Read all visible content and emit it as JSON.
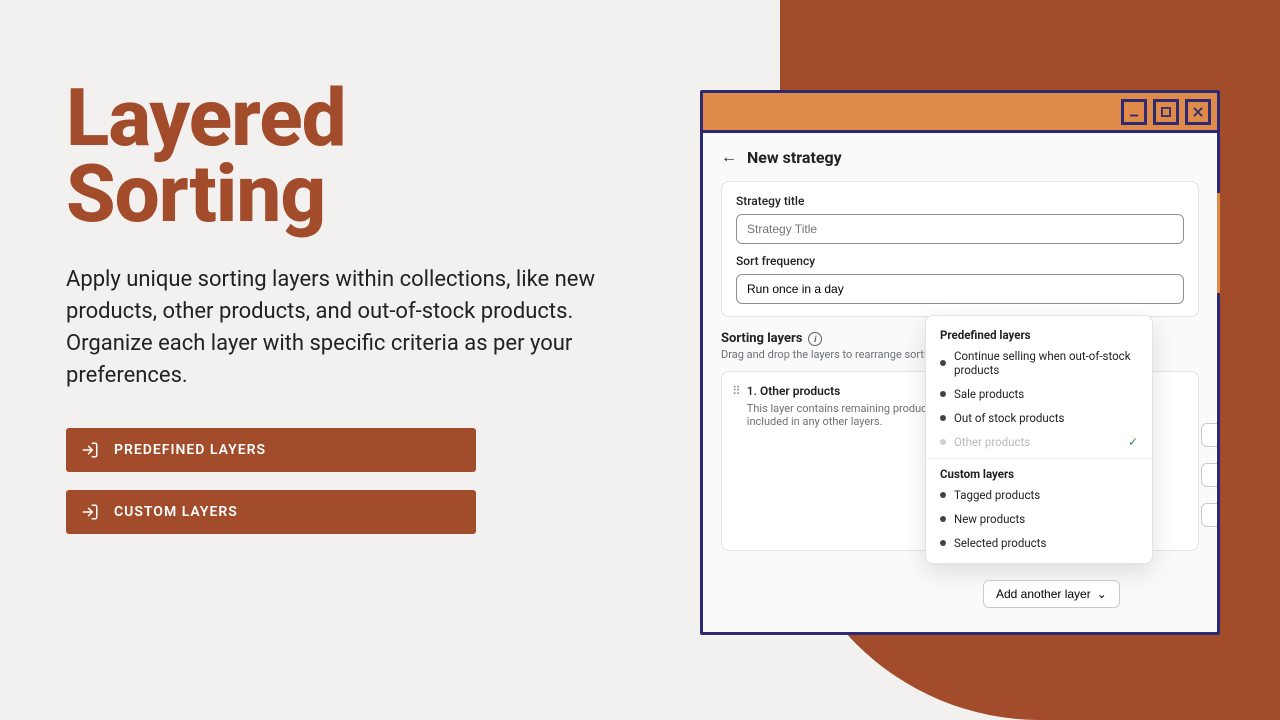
{
  "hero": {
    "title_line1": "Layered",
    "title_line2": "Sorting",
    "description": "Apply unique sorting layers within collections, like new products, other products, and out-of-stock products. Organize each layer with specific criteria as per your preferences.",
    "pills": {
      "predefined": "PREDEFINED LAYERS",
      "custom": "CUSTOM LAYERS"
    }
  },
  "window": {
    "page_title": "New strategy",
    "fields": {
      "title_label": "Strategy title",
      "title_placeholder": "Strategy Title",
      "freq_label": "Sort frequency",
      "freq_value": "Run once in a day"
    },
    "sorting_layers": {
      "heading": "Sorting layers",
      "subheading": "Drag and drop the layers to rearrange sorting or",
      "layer1": {
        "index": "1.",
        "name": "Other products",
        "desc": "This layer contains remaining products of are not included in any other layers."
      }
    },
    "dropdown": {
      "predefined_heading": "Predefined layers",
      "predefined": {
        "continue": "Continue selling when out-of-stock products",
        "sale": "Sale products",
        "oos": "Out of stock products",
        "other": "Other products"
      },
      "custom_heading": "Custom layers",
      "custom": {
        "tagged": "Tagged products",
        "new": "New products",
        "selected": "Selected products"
      }
    },
    "add_button": "Add another layer"
  }
}
